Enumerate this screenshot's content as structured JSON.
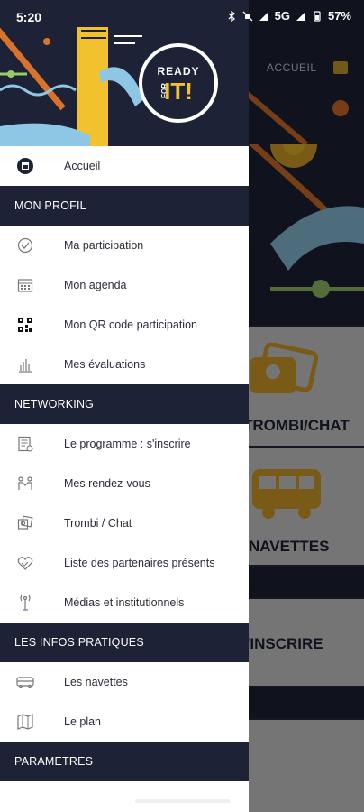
{
  "status_bar": {
    "time": "5:20",
    "network": "5G",
    "battery": "57%"
  },
  "background_app": {
    "header_link": "ACCUEIL",
    "tiles": [
      {
        "label": "TROMBI/CHAT"
      },
      {
        "label": "NAVETTES"
      },
      {
        "label": "S'INSCRIRE"
      }
    ]
  },
  "drawer": {
    "logo": {
      "line1": "READY",
      "line2": "IT!",
      "line3": "FOR"
    },
    "home": {
      "label": "Accueil",
      "icon": "home-logo-icon"
    },
    "sections": [
      {
        "title": "MON PROFIL",
        "items": [
          {
            "label": "Ma participation",
            "icon": "check-circle-icon"
          },
          {
            "label": "Mon agenda",
            "icon": "calendar-icon"
          },
          {
            "label": "Mon QR code participation",
            "icon": "qr-code-icon"
          },
          {
            "label": "Mes évaluations",
            "icon": "bar-chart-icon"
          }
        ]
      },
      {
        "title": "NETWORKING",
        "items": [
          {
            "label": "Le programme : s'inscrire",
            "icon": "document-icon"
          },
          {
            "label": "Mes rendez-vous",
            "icon": "meeting-icon"
          },
          {
            "label": "Trombi / Chat",
            "icon": "photos-icon"
          },
          {
            "label": "Liste des partenaires présents",
            "icon": "handshake-icon"
          },
          {
            "label": "Médias et institutionnels",
            "icon": "antenna-icon"
          }
        ]
      },
      {
        "title": "LES INFOS PRATIQUES",
        "items": [
          {
            "label": "Les navettes",
            "icon": "bus-icon"
          },
          {
            "label": "Le plan",
            "icon": "map-icon"
          }
        ]
      },
      {
        "title": "PARAMETRES",
        "items": []
      }
    ]
  }
}
